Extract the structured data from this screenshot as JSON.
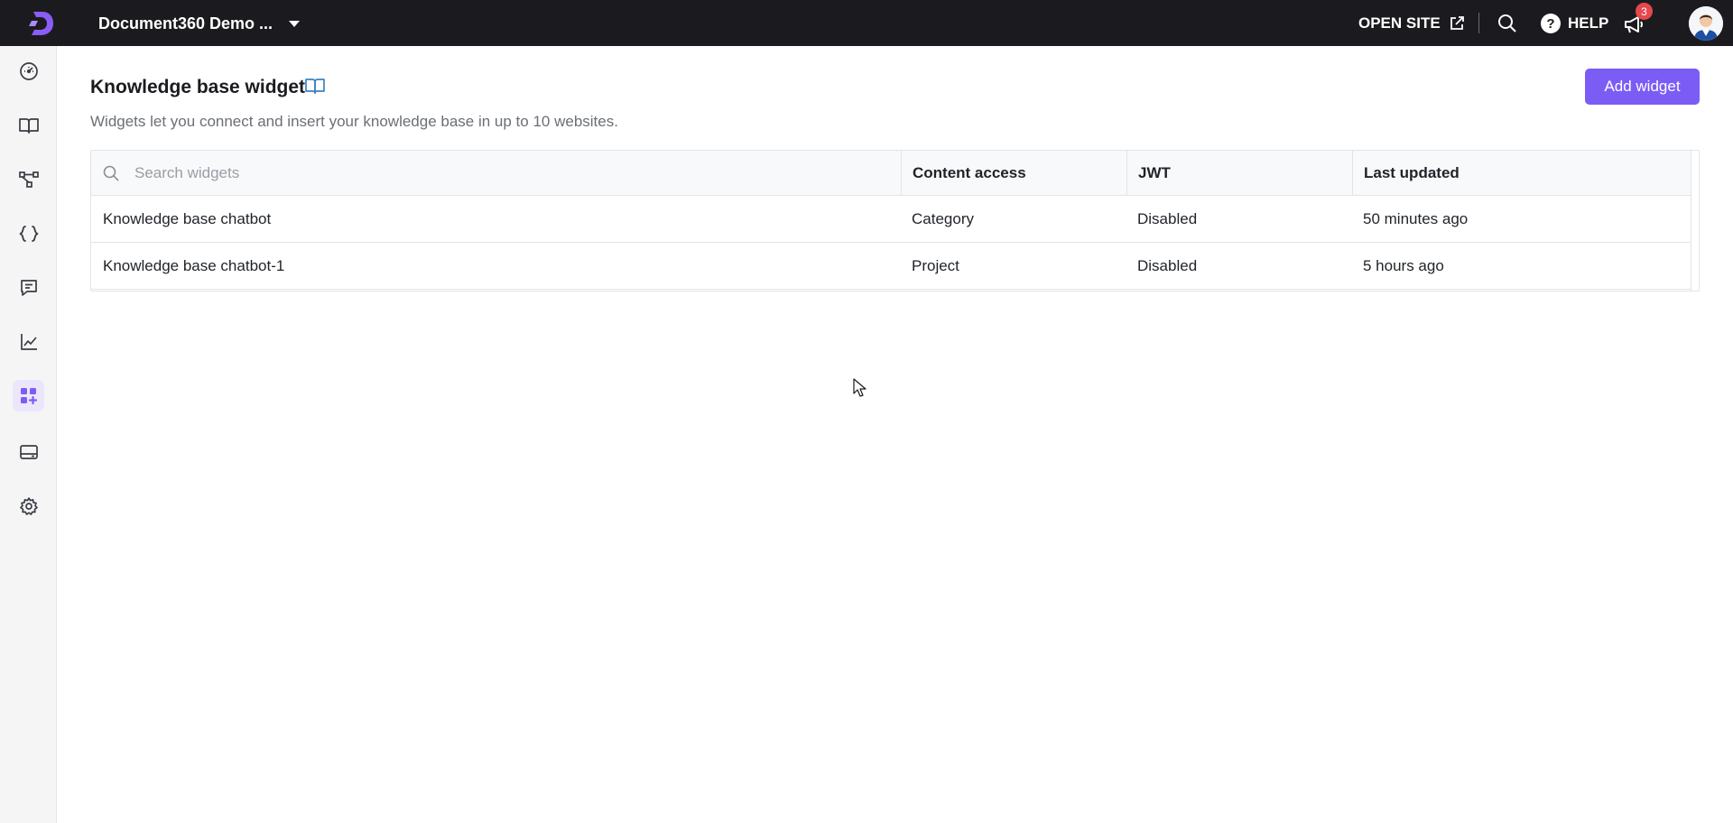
{
  "topbar": {
    "project_name": "Document360 Demo ...",
    "open_site_label": "OPEN SITE",
    "help_label": "HELP",
    "notification_count": "3"
  },
  "sidebar": {
    "items": [
      {
        "name": "dashboard",
        "icon": "gauge-icon"
      },
      {
        "name": "documentation",
        "icon": "book-icon"
      },
      {
        "name": "workflow",
        "icon": "flow-icon"
      },
      {
        "name": "api-docs",
        "icon": "braces-icon"
      },
      {
        "name": "feedback",
        "icon": "comment-icon"
      },
      {
        "name": "analytics",
        "icon": "chart-icon"
      },
      {
        "name": "widgets",
        "icon": "widget-icon",
        "active": true
      },
      {
        "name": "site-builder",
        "icon": "layout-icon"
      },
      {
        "name": "settings",
        "icon": "gear-icon"
      }
    ]
  },
  "page": {
    "title": "Knowledge base widget",
    "subtitle": "Widgets let you connect and insert your knowledge base in up to 10 websites.",
    "add_button": "Add widget"
  },
  "table": {
    "search_placeholder": "Search widgets",
    "columns": [
      "Content access",
      "JWT",
      "Last updated"
    ],
    "rows": [
      {
        "name": "Knowledge base chatbot",
        "content_access": "Category",
        "jwt": "Disabled",
        "last_updated": "50 minutes ago"
      },
      {
        "name": "Knowledge base chatbot-1",
        "content_access": "Project",
        "jwt": "Disabled",
        "last_updated": "5 hours ago"
      }
    ]
  },
  "colors": {
    "accent": "#7b5cf5",
    "topbar": "#1b1b1f",
    "badge": "#e5484d"
  }
}
